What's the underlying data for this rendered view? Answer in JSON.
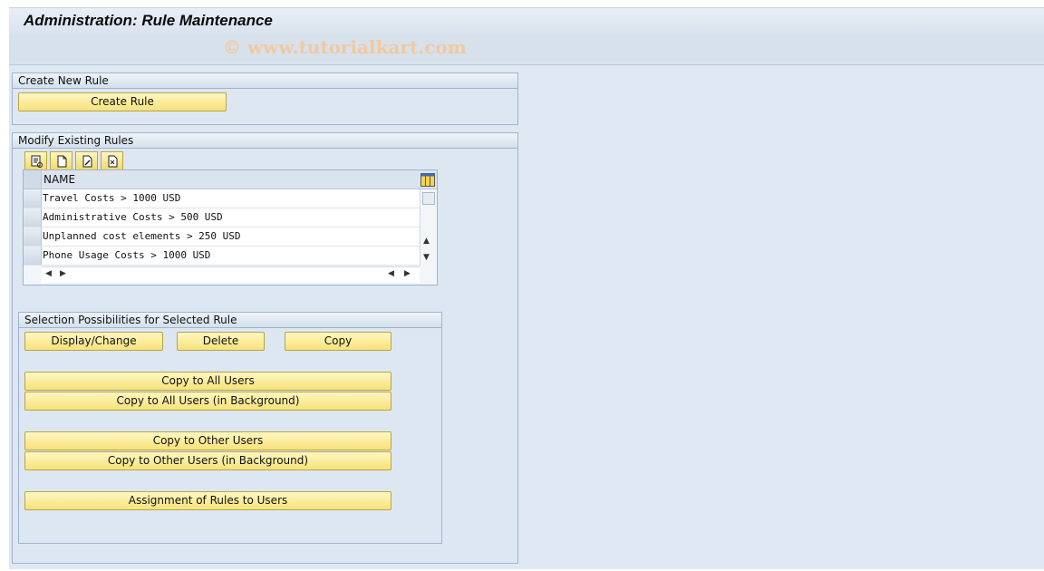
{
  "window": {
    "title": "Administration: Rule Maintenance"
  },
  "watermark": "© www.tutorialkart.com",
  "create_group": {
    "title": "Create New Rule",
    "create_button": "Create Rule"
  },
  "modify_group": {
    "title": "Modify Existing Rules",
    "toolbar_icons": [
      "details-icon",
      "create-icon",
      "change-icon",
      "delete-icon"
    ],
    "table": {
      "column": "NAME",
      "rows": [
        "Travel Costs > 1000 USD",
        "Administrative Costs > 500 USD",
        "Unplanned cost elements > 250 USD",
        "Phone Usage Costs > 1000 USD"
      ]
    },
    "selection": {
      "title": "Selection Possibilities for Selected Rule",
      "display_change": "Display/Change",
      "delete": "Delete",
      "copy": "Copy",
      "copy_all": "Copy to All Users",
      "copy_all_bg": "Copy to All Users (in Background)",
      "copy_other": "Copy to Other Users",
      "copy_other_bg": "Copy to Other Users (in Background)",
      "assignment": "Assignment of Rules to Users"
    }
  },
  "colors": {
    "button_yellow": "#f6e27a",
    "panel_blue": "#dde7f2",
    "watermark": "#f4c89e"
  }
}
